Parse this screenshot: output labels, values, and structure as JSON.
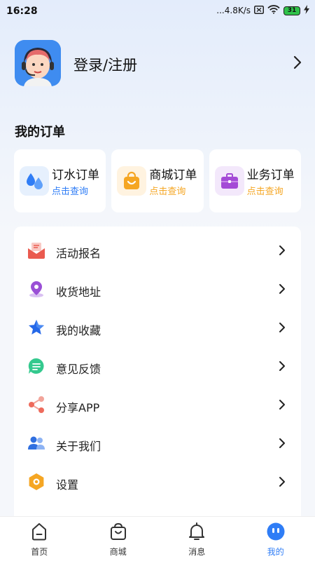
{
  "status_bar": {
    "time": "16:28",
    "network_speed": "...4.8K/s",
    "battery": "31"
  },
  "profile": {
    "login_label": "登录/注册"
  },
  "orders": {
    "title": "我的订单",
    "cards": [
      {
        "label": "订水订单",
        "sub": "点击查询",
        "icon": "water-drop-icon",
        "sub_color": "#2f7df6"
      },
      {
        "label": "商城订单",
        "sub": "点击查询",
        "icon": "shopping-bag-icon",
        "sub_color": "#f5a623"
      },
      {
        "label": "业务订单",
        "sub": "点击查询",
        "icon": "briefcase-icon",
        "sub_color": "#f5a623"
      }
    ]
  },
  "menu": {
    "items": [
      {
        "label": "活动报名",
        "icon": "mail-envelope-icon"
      },
      {
        "label": "收货地址",
        "icon": "location-pin-icon"
      },
      {
        "label": "我的收藏",
        "icon": "star-icon"
      },
      {
        "label": "意见反馈",
        "icon": "chat-bubble-icon"
      },
      {
        "label": "分享APP",
        "icon": "share-icon"
      },
      {
        "label": "关于我们",
        "icon": "people-icon"
      },
      {
        "label": "设置",
        "icon": "settings-hexagon-icon"
      }
    ]
  },
  "bottom_nav": {
    "items": [
      {
        "label": "首页",
        "icon": "home-icon"
      },
      {
        "label": "商城",
        "icon": "shop-bag-icon"
      },
      {
        "label": "消息",
        "icon": "bell-icon"
      },
      {
        "label": "我的",
        "icon": "robot-face-icon"
      }
    ],
    "active_index": 3,
    "active_color": "#2f7df6"
  }
}
